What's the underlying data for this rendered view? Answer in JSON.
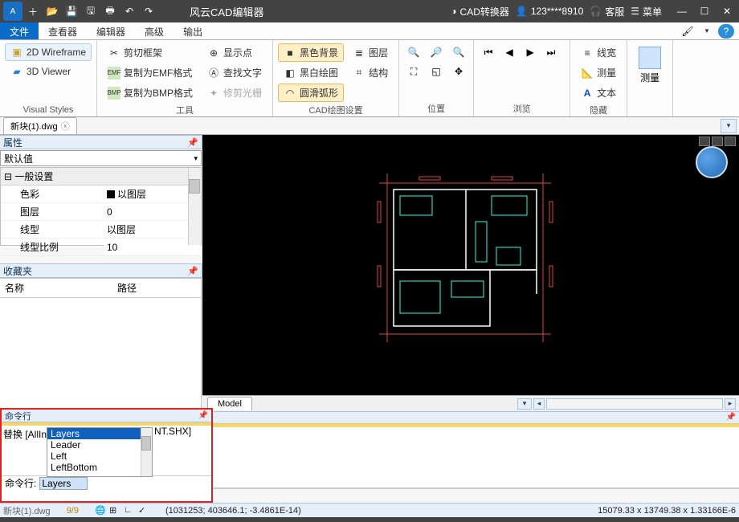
{
  "titlebar": {
    "app_name": "风云CAD编辑器",
    "cad_converter": "CAD转换器",
    "user": "123****8910",
    "support": "客服",
    "menu": "菜单"
  },
  "menubar": {
    "tabs": [
      "文件",
      "查看器",
      "编辑器",
      "高级",
      "输出"
    ],
    "active_index": 0
  },
  "ribbon": {
    "visual_styles": {
      "label": "Visual Styles",
      "wireframe": "2D Wireframe",
      "viewer3d": "3D Viewer"
    },
    "tools": {
      "label": "工具",
      "clip_frame": "剪切框架",
      "copy_emf": "复制为EMF格式",
      "copy_bmp": "复制为BMP格式",
      "show_point": "显示点",
      "find_text": "查找文字",
      "trim_light": "修剪光栅"
    },
    "cad_settings": {
      "label": "CAD绘图设置",
      "black_bg": "黑色背景",
      "bw_draw": "黑白绘图",
      "smooth_arc": "圆滑弧形",
      "layer": "图层",
      "structure": "结构"
    },
    "position": {
      "label": "位置"
    },
    "browse": {
      "label": "浏览"
    },
    "hide": {
      "label": "隐藏",
      "linewidth": "线宽",
      "measure": "测量",
      "text": "文本"
    },
    "measure_big": {
      "label": "测量"
    }
  },
  "doc_tab": {
    "name": "新块(1).dwg"
  },
  "properties_panel": {
    "title": "属性",
    "default": "默认值",
    "section_general": "一般设置",
    "rows": {
      "color": {
        "k": "色彩",
        "v": "以图层"
      },
      "layer": {
        "k": "图层",
        "v": "0"
      },
      "linetype": {
        "k": "线型",
        "v": "以图层"
      },
      "linescale": {
        "k": "线型比例",
        "v": "10"
      }
    }
  },
  "favorites_panel": {
    "title": "收藏夹",
    "col_name": "名称",
    "col_path": "路径"
  },
  "canvas": {
    "model_tab": "Model"
  },
  "command": {
    "title": "命令行",
    "prefix": "替换 [AllIn",
    "suffix": "NT.SHX]",
    "options": [
      "Layers",
      "Leader",
      "Left",
      "LeftBottom"
    ],
    "selected_index": 0,
    "input_label": "命令行:",
    "input_value": "Layers"
  },
  "statusbar": {
    "file": "新块(1).dwg",
    "fraction": "9/9",
    "coords": "(1031253; 403646.1; -3.4861E-14)",
    "right": "15079.33 x 13749.38 x 1.33166E-6"
  }
}
